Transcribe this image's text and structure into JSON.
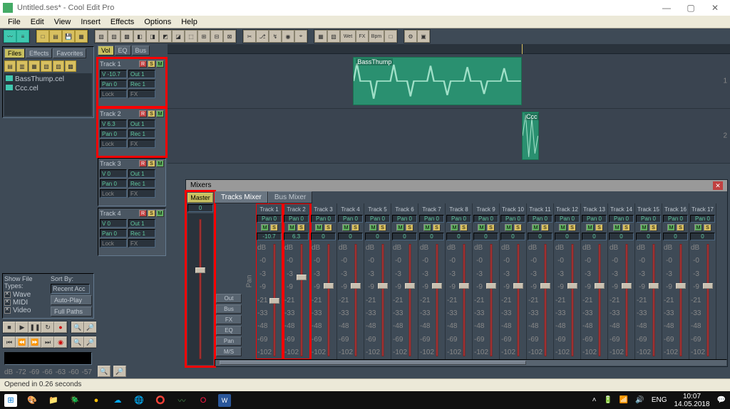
{
  "window": {
    "title": "Untitled.ses* - Cool Edit Pro"
  },
  "menu": [
    "File",
    "Edit",
    "View",
    "Insert",
    "Effects",
    "Options",
    "Help"
  ],
  "left_tabs": [
    "Files",
    "Effects",
    "Favorites"
  ],
  "files": [
    "BassThump.cel",
    "Ccc.cel"
  ],
  "show_file_types": {
    "label": "Show File Types:",
    "sort_label": "Sort By:",
    "sort": "Recent Acc",
    "auto": "Auto-Play",
    "full": "Full Paths",
    "types": [
      "Wave",
      "MIDI",
      "Video"
    ]
  },
  "veb": [
    "Vol",
    "EQ",
    "Bus"
  ],
  "tracks": [
    {
      "name": "Track 1",
      "vol": "V -10.7",
      "out": "Out 1",
      "pan": "Pan 0",
      "rec": "Rec 1",
      "lock": "Lock",
      "fx": "FX"
    },
    {
      "name": "Track 2",
      "vol": "V 6.3",
      "out": "Out 1",
      "pan": "Pan 0",
      "rec": "Rec 1",
      "lock": "Lock",
      "fx": "FX"
    },
    {
      "name": "Track 3",
      "vol": "V 0",
      "out": "Out 1",
      "pan": "Pan 0",
      "rec": "Rec 1",
      "lock": "Lock",
      "fx": "FX"
    },
    {
      "name": "Track 4",
      "vol": "V 0",
      "out": "Out 1",
      "pan": "Pan 0",
      "rec": "Rec 1",
      "lock": "Lock",
      "fx": "FX"
    }
  ],
  "clips": [
    {
      "label": "BassThump"
    },
    {
      "label": "Ccc"
    }
  ],
  "mixer": {
    "title": "Mixers",
    "master": "Master",
    "master_vol": "0",
    "tabs": [
      "Tracks Mixer",
      "Bus Mixer"
    ],
    "side": [
      "Out",
      "Bus",
      "FX",
      "EQ",
      "Pan",
      "M/S"
    ],
    "strips": [
      {
        "name": "Track 1",
        "pan": "Pan 0",
        "vol": "-10.7"
      },
      {
        "name": "Track 2",
        "pan": "Pan 0",
        "vol": "6.3"
      },
      {
        "name": "Track 3",
        "pan": "Pan 0",
        "vol": "0"
      },
      {
        "name": "Track 4",
        "pan": "Pan 0",
        "vol": "0"
      },
      {
        "name": "Track 5",
        "pan": "Pan 0",
        "vol": "0"
      },
      {
        "name": "Track 6",
        "pan": "Pan 0",
        "vol": "0"
      },
      {
        "name": "Track 7",
        "pan": "Pan 0",
        "vol": "0"
      },
      {
        "name": "Track 8",
        "pan": "Pan 0",
        "vol": "0"
      },
      {
        "name": "Track 9",
        "pan": "Pan 0",
        "vol": "0"
      },
      {
        "name": "Track 10",
        "pan": "Pan 0",
        "vol": "0"
      },
      {
        "name": "Track 11",
        "pan": "Pan 0",
        "vol": "0"
      },
      {
        "name": "Track 12",
        "pan": "Pan 0",
        "vol": "0"
      },
      {
        "name": "Track 13",
        "pan": "Pan 0",
        "vol": "0"
      },
      {
        "name": "Track 14",
        "pan": "Pan 0",
        "vol": "0"
      },
      {
        "name": "Track 15",
        "pan": "Pan 0",
        "vol": "0"
      },
      {
        "name": "Track 16",
        "pan": "Pan 0",
        "vol": "0"
      },
      {
        "name": "Track 17",
        "pan": "Pan 0",
        "vol": "0"
      }
    ],
    "ticks": [
      "dB",
      "-0",
      "-3",
      "-9",
      "-21",
      "-33",
      "-48",
      "-69",
      "-102"
    ],
    "pan_label": "Pan"
  },
  "meter": [
    "dB",
    "-72",
    "-69",
    "-66",
    "-63",
    "-60",
    "-57"
  ],
  "status": "Opened in 0.26 seconds",
  "tray": {
    "lang": "ENG",
    "time": "10:07",
    "date": "14.05.2018"
  }
}
